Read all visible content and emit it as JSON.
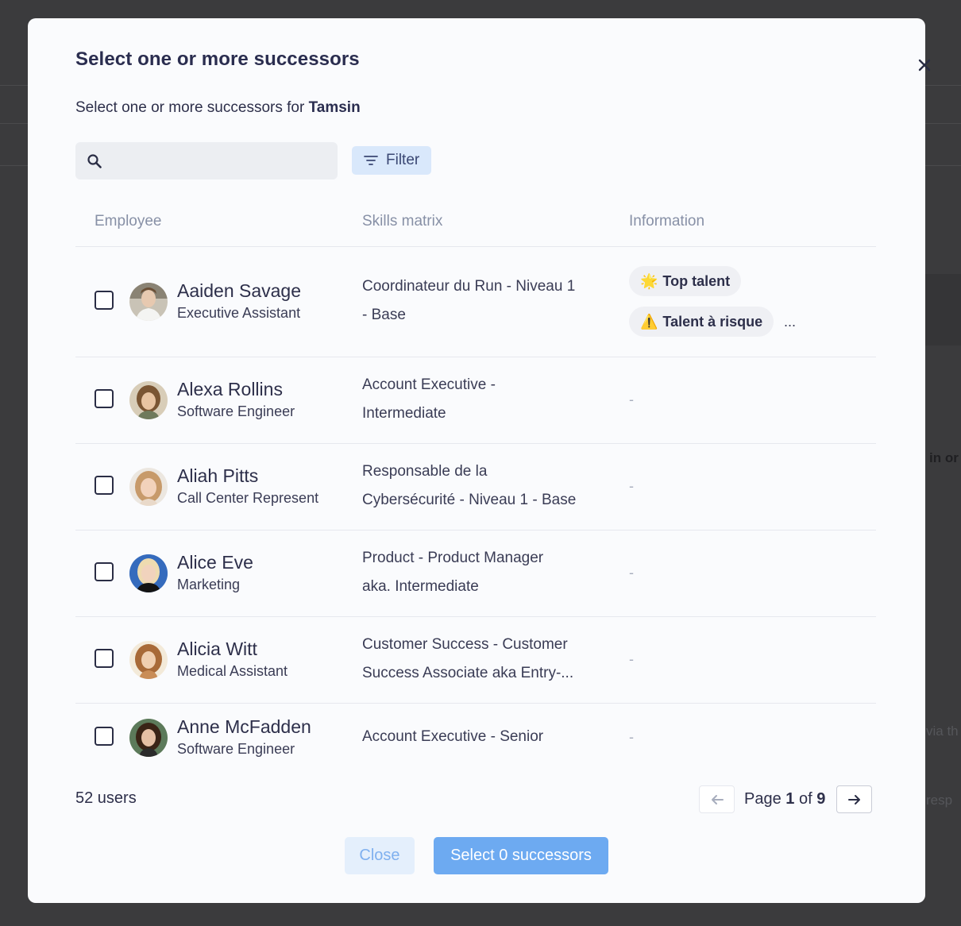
{
  "background": {
    "partial_texts": [
      "in or",
      "via th",
      "resp"
    ]
  },
  "modal": {
    "title": "Select one or more successors",
    "subtitle_prefix": "Select one or more successors for",
    "subtitle_name": "Tamsin",
    "search": {
      "placeholder": "",
      "value": ""
    },
    "filter_label": "Filter",
    "columns": {
      "employee": "Employee",
      "skills": "Skills matrix",
      "information": "Information"
    },
    "rows": [
      {
        "name": "Aaiden Savage",
        "role": "Executive Assistant",
        "skill_line1": "Coordinateur du Run - Niveau 1",
        "skill_line2": "- Base",
        "tags": [
          {
            "emoji": "🌟",
            "label": "Top talent"
          },
          {
            "emoji": "⚠️",
            "label": "Talent à risque"
          }
        ],
        "more": "...",
        "checked": false
      },
      {
        "name": "Alexa Rollins",
        "role": "Software Engineer",
        "skill_line1": "Account Executive -",
        "skill_line2": "Intermediate",
        "info": "-",
        "checked": false
      },
      {
        "name": "Aliah Pitts",
        "role": "Call Center Represent",
        "skill_line1": "Responsable de la",
        "skill_line2": "Cybersécurité - Niveau 1 - Base",
        "info": "-",
        "checked": false
      },
      {
        "name": "Alice Eve",
        "role": "Marketing",
        "skill_line1": "Product - Product Manager",
        "skill_line2": "aka. Intermediate",
        "info": "-",
        "checked": false
      },
      {
        "name": "Alicia Witt",
        "role": "Medical Assistant",
        "skill_line1": "Customer Success - Customer",
        "skill_line2": "Success Associate aka Entry-...",
        "info": "-",
        "checked": false
      },
      {
        "name": "Anne McFadden",
        "role": "Software Engineer",
        "skill_line1": "Account Executive - Senior",
        "skill_line2": "",
        "info": "-",
        "checked": false
      }
    ],
    "users_count": "52 users",
    "pagination": {
      "prefix": "Page",
      "current": "1",
      "of": "of",
      "total": "9"
    },
    "close_label": "Close",
    "select_label": "Select 0 successors"
  }
}
